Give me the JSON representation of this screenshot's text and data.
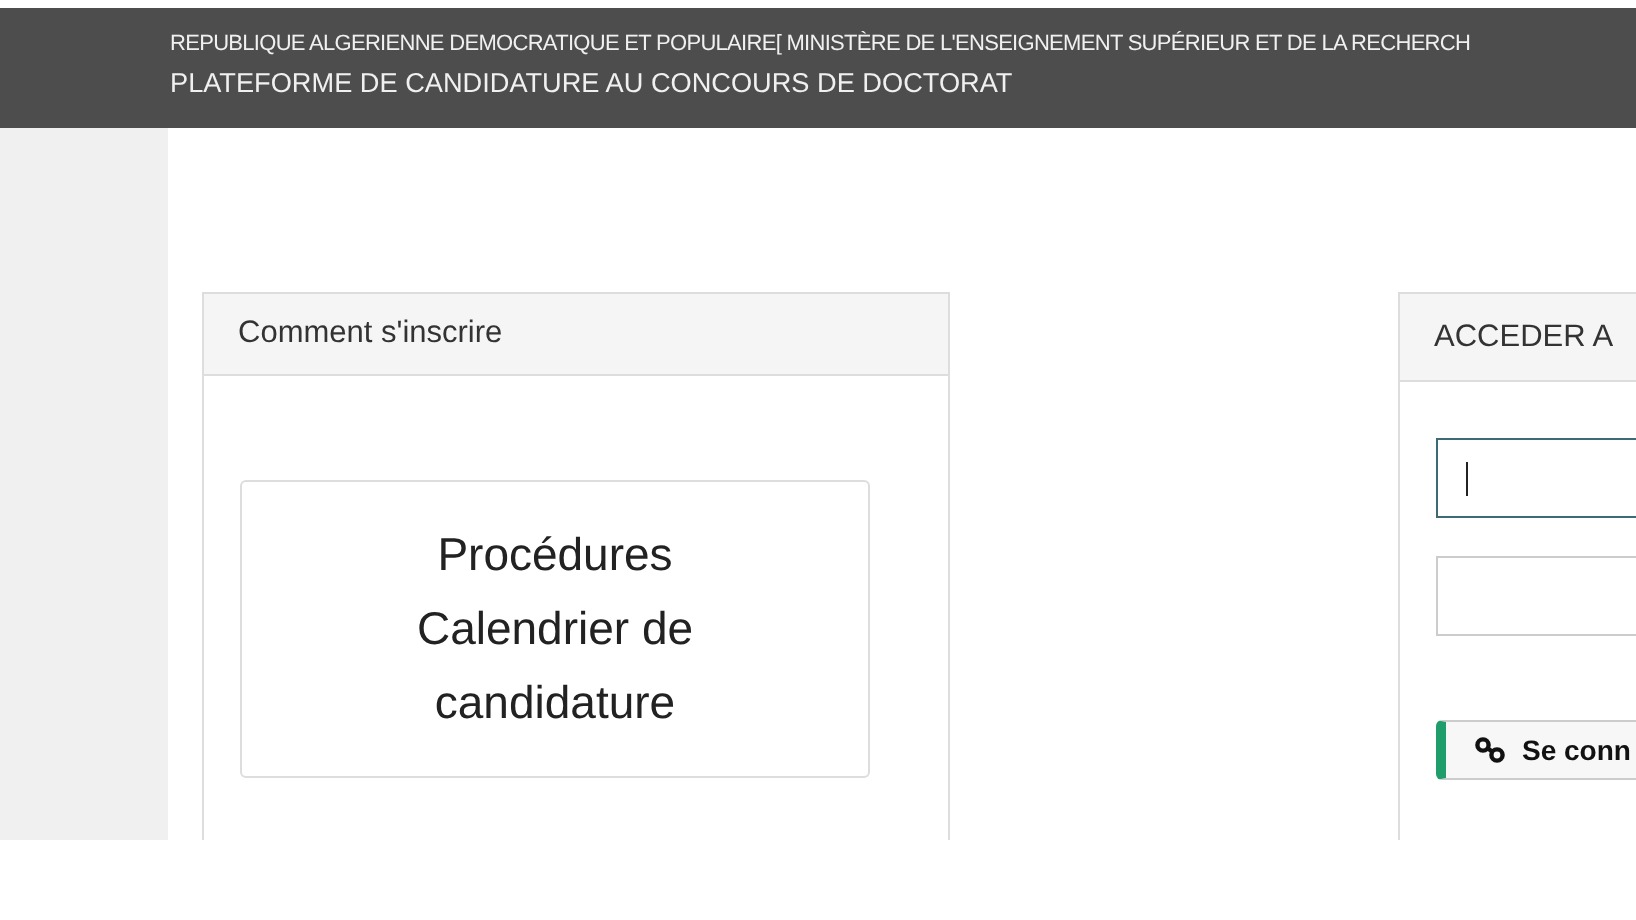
{
  "header": {
    "line_1": "REPUBLIQUE ALGERIENNE DEMOCRATIQUE ET POPULAIRE[ MINISTÈRE DE L'ENSEIGNEMENT SUPÉRIEUR ET DE LA RECHERCH",
    "line_2": "PLATEFORME DE CANDIDATURE AU CONCOURS DE DOCTORAT"
  },
  "info_card": {
    "title": "Comment s'inscrire",
    "links": [
      "Procédures",
      "Calendrier de candidature"
    ]
  },
  "login_card": {
    "title": "ACCEDER A",
    "fields": [
      {
        "focused": true
      },
      {
        "focused": false
      }
    ],
    "button": "Se conn"
  }
}
